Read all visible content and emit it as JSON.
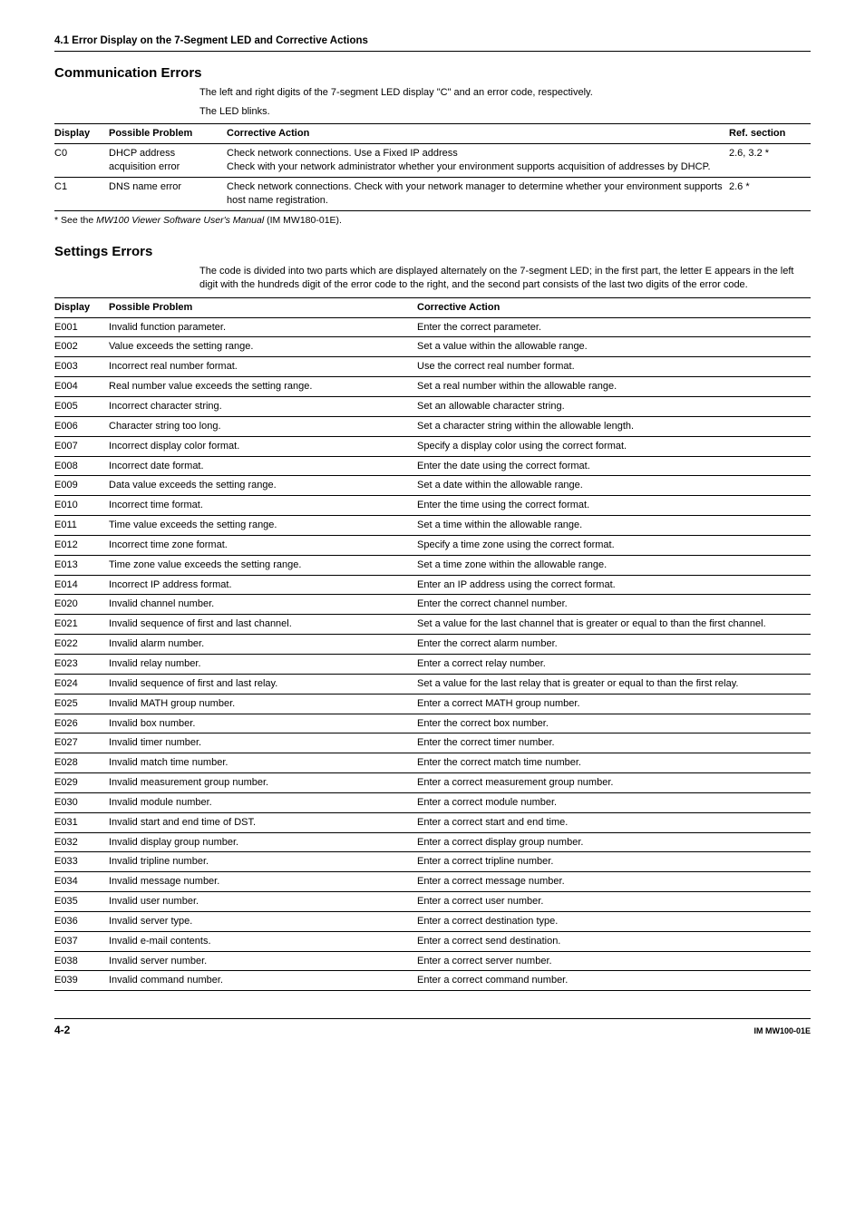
{
  "section_header": "4.1  Error Display on the 7-Segment LED and Corrective Actions",
  "comm": {
    "title": "Communication Errors",
    "intro1": "The left and right digits of the 7-segment LED display \"C\" and an error code, respectively.",
    "intro2": "The LED blinks.",
    "headers": {
      "display": "Display",
      "problem": "Possible Problem",
      "action": "Corrective Action",
      "ref": "Ref. section"
    },
    "rows": [
      {
        "display": "C0",
        "problem": "DHCP address acquisition error",
        "action": "Check network connections. Use a Fixed IP address\nCheck with your network administrator whether your environment supports acquisition of addresses by DHCP.",
        "ref": "2.6, 3.2 *"
      },
      {
        "display": "C1",
        "problem": "DNS name error",
        "action": "Check network connections. Check with your network manager to determine whether your environment supports host name registration.",
        "ref": "2.6 *"
      }
    ],
    "footnote_pre": "* See the ",
    "footnote_it": "MW100 Viewer Software User's Manual",
    "footnote_post": " (IM MW180-01E)."
  },
  "settings": {
    "title": "Settings Errors",
    "intro": "The code is divided into two parts which are displayed alternately on the 7-segment LED; in the first part, the letter E appears in the left digit with the hundreds digit of the error code to the right, and the second part consists of the last two digits of the error code.",
    "headers": {
      "display": "Display",
      "problem": "Possible Problem",
      "action": "Corrective Action"
    },
    "rows": [
      {
        "d": "E001",
        "p": "Invalid function parameter.",
        "a": "Enter the correct parameter."
      },
      {
        "d": "E002",
        "p": "Value exceeds the setting range.",
        "a": "Set a value within the allowable range."
      },
      {
        "d": "E003",
        "p": "Incorrect real number format.",
        "a": "Use the correct real number format."
      },
      {
        "d": "E004",
        "p": "Real number value exceeds the setting range.",
        "a": "Set a real number within the allowable range."
      },
      {
        "d": "E005",
        "p": "Incorrect character string.",
        "a": "Set an allowable character string."
      },
      {
        "d": "E006",
        "p": "Character string too long.",
        "a": "Set a character string within the allowable length."
      },
      {
        "d": "E007",
        "p": "Incorrect display color format.",
        "a": "Specify a display color using the correct format."
      },
      {
        "d": "E008",
        "p": "Incorrect date format.",
        "a": "Enter the date using the correct format."
      },
      {
        "d": "E009",
        "p": "Data value exceeds the setting range.",
        "a": "Set a date within the allowable range."
      },
      {
        "d": "E010",
        "p": "Incorrect time format.",
        "a": "Enter the time using the correct format."
      },
      {
        "d": "E011",
        "p": "Time value exceeds the setting range.",
        "a": "Set a time within the allowable range."
      },
      {
        "d": "E012",
        "p": "Incorrect time zone format.",
        "a": "Specify a time zone using the correct format."
      },
      {
        "d": "E013",
        "p": "Time zone value exceeds the setting range.",
        "a": "Set a time zone within the allowable range."
      },
      {
        "d": "E014",
        "p": "Incorrect IP address format.",
        "a": "Enter an IP address using the correct format."
      },
      {
        "d": "E020",
        "p": "Invalid channel number.",
        "a": "Enter the correct channel number."
      },
      {
        "d": "E021",
        "p": "Invalid sequence of first and last channel.",
        "a": "Set a value for the last channel that is greater or equal to than the first channel."
      },
      {
        "d": "E022",
        "p": "Invalid alarm number.",
        "a": "Enter the correct alarm number."
      },
      {
        "d": "E023",
        "p": "Invalid relay number.",
        "a": "Enter a correct relay number."
      },
      {
        "d": "E024",
        "p": "Invalid sequence of first and last relay.",
        "a": "Set a value for the last relay that is greater or equal to than the first relay."
      },
      {
        "d": "E025",
        "p": "Invalid MATH group number.",
        "a": "Enter a correct MATH group number."
      },
      {
        "d": "E026",
        "p": "Invalid box number.",
        "a": "Enter the correct box number."
      },
      {
        "d": "E027",
        "p": "Invalid timer number.",
        "a": "Enter the correct timer number."
      },
      {
        "d": "E028",
        "p": "Invalid match time number.",
        "a": "Enter the correct match time number."
      },
      {
        "d": "E029",
        "p": "Invalid measurement group number.",
        "a": "Enter a correct measurement group number."
      },
      {
        "d": "E030",
        "p": "Invalid module number.",
        "a": "Enter a correct module number."
      },
      {
        "d": "E031",
        "p": "Invalid start and end time of DST.",
        "a": "Enter a correct start and end time."
      },
      {
        "d": "E032",
        "p": "Invalid display group number.",
        "a": "Enter a correct display group number."
      },
      {
        "d": "E033",
        "p": "Invalid tripline number.",
        "a": "Enter a correct tripline number."
      },
      {
        "d": "E034",
        "p": "Invalid message number.",
        "a": "Enter a correct message number."
      },
      {
        "d": "E035",
        "p": "Invalid user number.",
        "a": "Enter a correct user number."
      },
      {
        "d": "E036",
        "p": "Invalid server type.",
        "a": "Enter a correct destination type."
      },
      {
        "d": "E037",
        "p": "Invalid e-mail contents.",
        "a": "Enter a correct send destination."
      },
      {
        "d": "E038",
        "p": "Invalid server number.",
        "a": "Enter a correct server number."
      },
      {
        "d": "E039",
        "p": "Invalid command number.",
        "a": "Enter a correct command number."
      }
    ]
  },
  "footer": {
    "page": "4-2",
    "doc": "IM MW100-01E"
  }
}
